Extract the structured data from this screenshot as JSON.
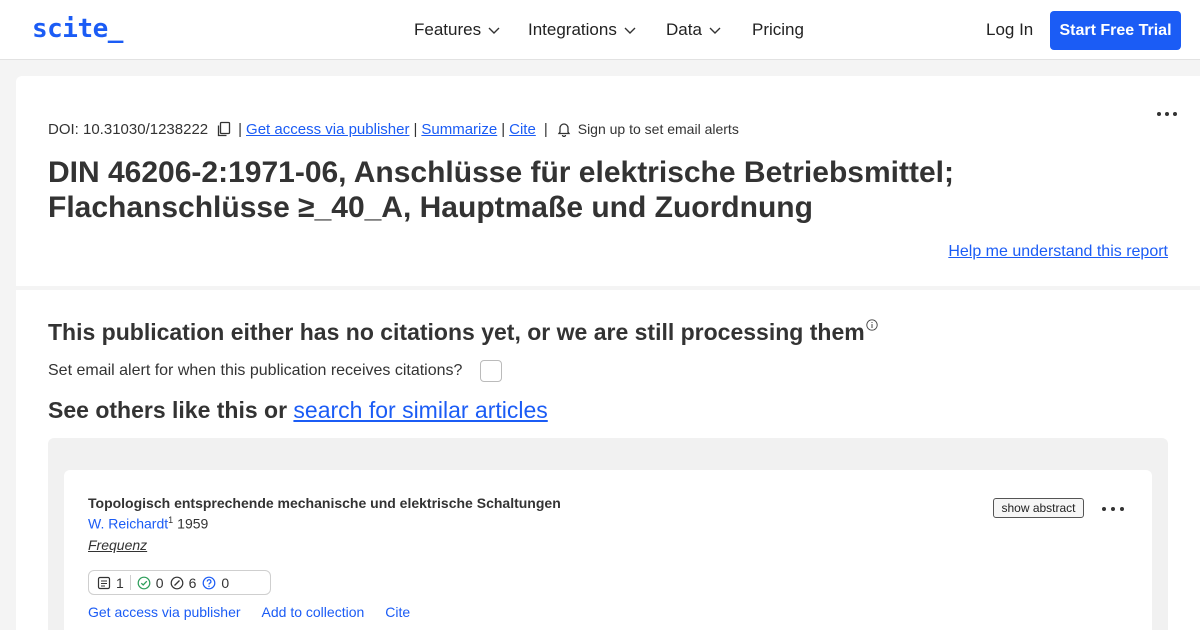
{
  "header": {
    "logo": "scite_",
    "nav": [
      {
        "label": "Features",
        "has_dropdown": true
      },
      {
        "label": "Integrations",
        "has_dropdown": true
      },
      {
        "label": "Data",
        "has_dropdown": true
      },
      {
        "label": "Pricing",
        "has_dropdown": false
      }
    ],
    "login_label": "Log In",
    "trial_label": "Start Free Trial"
  },
  "publication": {
    "doi": "DOI: 10.31030/1238222",
    "links": {
      "get_access": "Get access via publisher",
      "summarize": "Summarize",
      "cite": "Cite"
    },
    "alert_text": "Sign up to set email alerts",
    "title": "DIN 46206-2:1971-06, Anschlüsse für elektrische Betriebsmittel; Flachanschlüsse ≥_40_A, Hauptmaße und Zuordnung",
    "help_link": "Help me understand this report"
  },
  "citations": {
    "heading": "This publication either has no citations yet, or we are still processing them",
    "email_question": "Set email alert for when this publication receives citations?",
    "see_others_prefix": "See others like this or ",
    "see_others_link": "search for similar articles"
  },
  "similar": [
    {
      "title": "Topologisch entsprechende mechanische und elektrische Schaltungen",
      "author": "W. Reichardt",
      "author_sup": "1",
      "year": "1959",
      "journal": "Frequenz",
      "counts": {
        "publications": "1",
        "supporting": "0",
        "contrasting": "6",
        "mentioning": "0"
      },
      "show_abstract": "show abstract",
      "actions": [
        "Get access via publisher",
        "Add to collection",
        "Cite"
      ]
    }
  ],
  "colors": {
    "accent": "#1b5cf5",
    "supporting": "#2e9e5b",
    "contrasting": "#333333",
    "mentioning": "#1b5cf5"
  }
}
